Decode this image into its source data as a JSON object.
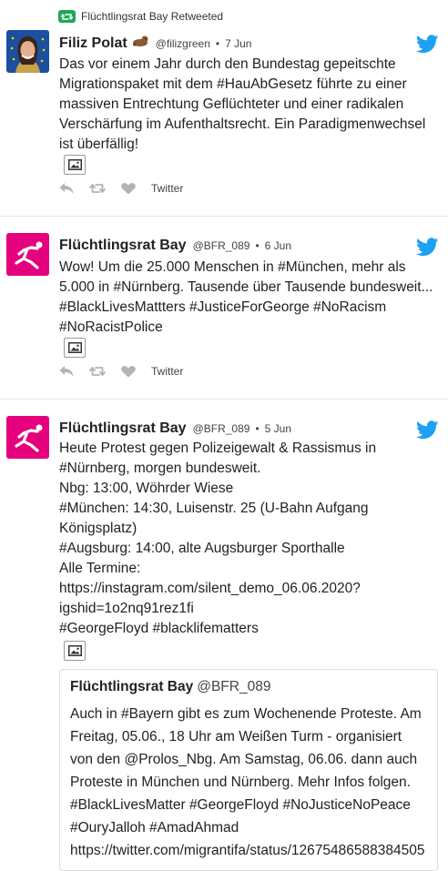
{
  "tweets": [
    {
      "retweet_label": "Flüchtlingsrat Bay Retweeted",
      "name": "Filiz Polat",
      "handle": "@filizgreen",
      "date": "7 Jun",
      "text": "Das vor einem Jahr durch den Bundestag gepeitschte\nMigrationspaket mit dem #HauAbGesetz führte zu einer\nmassiven Entrechtung Geflüchteter und einer radikalen\nVerschärfung im Aufenthaltsrecht. Ein Paradigmenwechsel\nist überfällig!",
      "via": "Twitter",
      "avatar_icon": "person-photo"
    },
    {
      "name": "Flüchtlingsrat Bay",
      "handle": "@BFR_089",
      "date": "6 Jun",
      "text": "Wow! Um die 25.000 Menschen in #München, mehr als\n5.000 in #Nürnberg. Tausende über Tausende bundesweit...\n#BlackLivesMattters #JusticeForGeorge #NoRacism\n#NoRacistPolice",
      "via": "Twitter",
      "avatar_icon": "runner-logo"
    },
    {
      "name": "Flüchtlingsrat Bay",
      "handle": "@BFR_089",
      "date": "5 Jun",
      "text": "Heute Protest gegen Polizeigewalt & Rassismus in\n#Nürnberg, morgen bundesweit.\nNbg: 13:00, Wöhrder Wiese\n#München: 14:30, Luisenstr. 25 (U-Bahn Aufgang\nKönigsplatz)\n#Augsburg: 14:00, alte Augsburger Sporthalle\nAlle Termine:\nhttps://instagram.com/silent_demo_06.06.2020?\nigshid=1o2nq91rez1fi\n#GeorgeFloyd #blacklifematters",
      "avatar_icon": "runner-logo",
      "quote": {
        "name": "Flüchtlingsrat Bay",
        "handle": "@BFR_089",
        "text": "Auch in #Bayern gibt es zum Wochenende Proteste. Am\nFreitag, 05.06., 18 Uhr am Weißen Turm - organisiert\nvon den @Prolos_Nbg. Am Samstag, 06.06. dann auch\nProteste in München und Nürnberg. Mehr Infos folgen.\n#BlackLivesMatter #GeorgeFloyd #NoJusticeNoPeace\n#OuryJalloh #AmadAhmad\nhttps://twitter.com/migrantifa/status/12675486588384505"
      }
    }
  ],
  "colors": {
    "twitter_blue": "#1da1f2",
    "retweet_green": "#1ea953",
    "brand_magenta": "#e5007d",
    "action_gray": "#b3b3b3"
  }
}
